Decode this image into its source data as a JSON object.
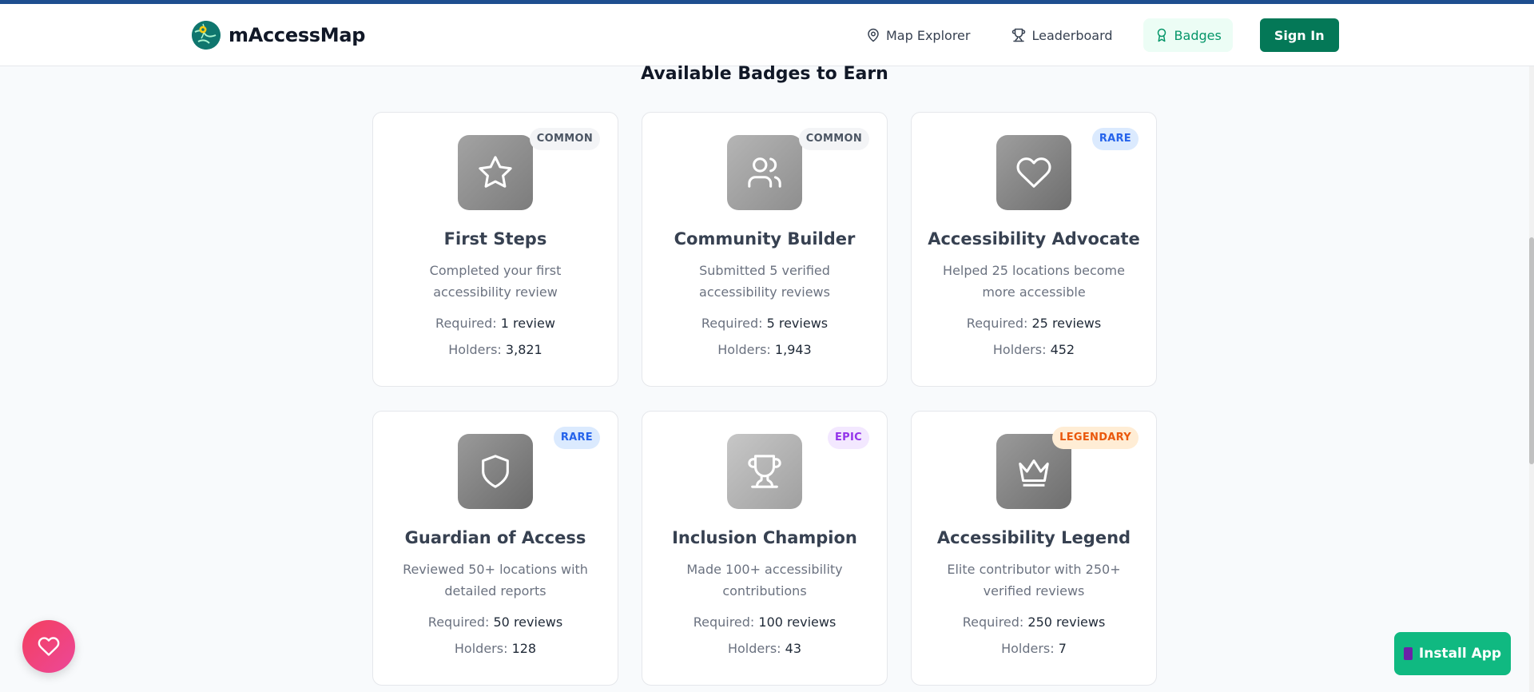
{
  "header": {
    "brand": "mAccessMap",
    "nav": [
      {
        "label": "Map Explorer",
        "icon": "map-pin-icon"
      },
      {
        "label": "Leaderboard",
        "icon": "trophy-icon"
      },
      {
        "label": "Badges",
        "icon": "award-icon",
        "active": true
      }
    ],
    "signin_label": "Sign In"
  },
  "section_title": "Available Badges to Earn",
  "labels": {
    "required": "Required:",
    "holders": "Holders:"
  },
  "badges": [
    {
      "name": "First Steps",
      "rarity": "COMMON",
      "icon": "star-icon",
      "description": "Completed your first accessibility review",
      "required": "1 review",
      "holders": "3,821"
    },
    {
      "name": "Community Builder",
      "rarity": "COMMON",
      "icon": "users-icon",
      "description": "Submitted 5 verified accessibility reviews",
      "required": "5 reviews",
      "holders": "1,943"
    },
    {
      "name": "Accessibility Advocate",
      "rarity": "RARE",
      "icon": "heart-icon",
      "description": "Helped 25 locations become more accessible",
      "required": "25 reviews",
      "holders": "452"
    },
    {
      "name": "Guardian of Access",
      "rarity": "RARE",
      "icon": "shield-icon",
      "description": "Reviewed 50+ locations with detailed reports",
      "required": "50 reviews",
      "holders": "128"
    },
    {
      "name": "Inclusion Champion",
      "rarity": "EPIC",
      "icon": "trophy-icon",
      "description": "Made 100+ accessibility contributions",
      "required": "100 reviews",
      "holders": "43"
    },
    {
      "name": "Accessibility Legend",
      "rarity": "LEGENDARY",
      "icon": "crown-icon",
      "description": "Elite contributor with 250+ verified reviews",
      "required": "250 reviews",
      "holders": "7"
    }
  ],
  "install_label": "Install App",
  "colors": {
    "brand_green": "#047857",
    "accent_green": "#10b981",
    "top_accent": "#1e4e8f"
  }
}
